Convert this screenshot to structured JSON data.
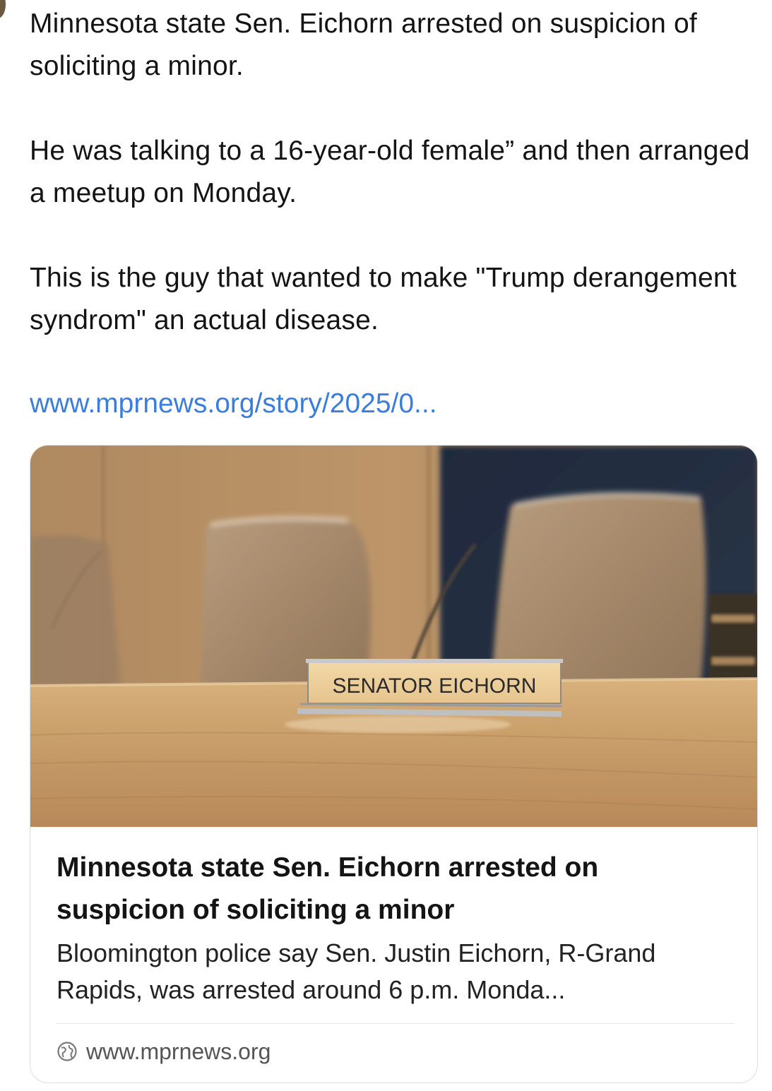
{
  "post": {
    "paragraphs": [
      "Minnesota state Sen. Eichorn arrested on suspicion of soliciting a minor.",
      "He was talking to a 16-year-old female” and then arranged a meetup on Monday.",
      "This is the guy that wanted to make \"Trump derangement syndrom\" an actual disease."
    ],
    "link_text": "www.mprnews.org/story/2025/0..."
  },
  "card": {
    "nameplate_text": "SENATOR EICHORN",
    "title": "Minnesota state Sen. Eichorn arrested on suspicion of soliciting a minor",
    "description": "Bloomington police say Sen. Justin Eichorn, R-Grand Rapids, was arrested around 6 p.m. Monda...",
    "source_domain": "www.mprnews.org"
  },
  "colors": {
    "link": "#3b7ddd",
    "text": "#141414",
    "muted": "#555555",
    "border": "#dedede"
  },
  "icons": {
    "source": "globe-icon"
  }
}
